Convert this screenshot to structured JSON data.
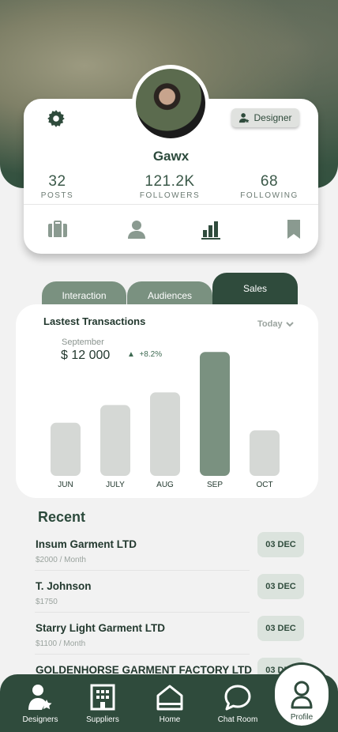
{
  "profile": {
    "name": "Gawx",
    "role_badge": "Designer",
    "stats": [
      {
        "value": "32",
        "label": "POSTS"
      },
      {
        "value": "121.2K",
        "label": "FOLLOWERS"
      },
      {
        "value": "68",
        "label": "FOLLOWING"
      }
    ],
    "icons": [
      "settings-gear-icon",
      "briefcase-icon",
      "person-icon",
      "bar-chart-icon",
      "bookmark-icon"
    ]
  },
  "tabs": [
    {
      "label": "Interaction",
      "active": false
    },
    {
      "label": "Audiences",
      "active": false
    },
    {
      "label": "Sales",
      "active": true
    }
  ],
  "transactions": {
    "title": "Lastest Transactions",
    "period": "Today",
    "highlight_month": "September",
    "highlight_amount": "$ 12 000",
    "highlight_change": "+8.2%"
  },
  "chart_data": {
    "type": "bar",
    "categories": [
      "JUN",
      "JULY",
      "AUG",
      "SEP",
      "OCT"
    ],
    "values": [
      42,
      56,
      66,
      98,
      36
    ],
    "highlight_index": 3,
    "colors": {
      "normal": "#d5d8d5",
      "highlight": "#7a9180"
    },
    "ylim": [
      0,
      100
    ],
    "grid": false
  },
  "recent": {
    "title": "Recent",
    "items": [
      {
        "name": "Insum Garment LTD",
        "sub": "$2000 / Month",
        "date": "03 DEC"
      },
      {
        "name": "T. Johnson",
        "sub": "$1750",
        "date": "03 DEC"
      },
      {
        "name": "Starry Light Garment LTD",
        "sub": "$1100 / Month",
        "date": "03 DEC"
      },
      {
        "name": "GOLDENHORSE GARMENT FACTORY LTD",
        "sub": "",
        "date": "03 DEC"
      }
    ]
  },
  "nav": {
    "items": [
      {
        "label": "Designers",
        "icon": "designers-icon"
      },
      {
        "label": "Suppliers",
        "icon": "building-icon"
      },
      {
        "label": "Home",
        "icon": "home-icon"
      },
      {
        "label": "Chat Room",
        "icon": "chat-bubble-icon"
      },
      {
        "label": "Profile",
        "icon": "profile-icon",
        "active": true
      }
    ]
  },
  "colors": {
    "primary": "#2f4b3c",
    "secondary": "#7a9180",
    "badge_bg": "#dbe3dd"
  }
}
